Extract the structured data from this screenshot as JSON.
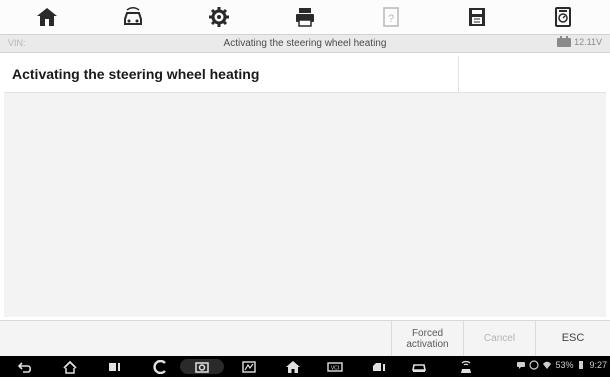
{
  "toolbar": {
    "buttons": [
      {
        "icon": "home-icon"
      },
      {
        "icon": "vehicle-swap-icon"
      },
      {
        "icon": "gear-icon"
      },
      {
        "icon": "print-icon"
      },
      {
        "icon": "help-icon"
      },
      {
        "icon": "save-icon"
      },
      {
        "icon": "data-logging-icon"
      }
    ]
  },
  "titlebar": {
    "vin_label": "VIN:",
    "title": "Activating the steering wheel heating",
    "voltage": "12.11V"
  },
  "content": {
    "row_title": "Activating the steering wheel heating",
    "row_value": ""
  },
  "functions": {
    "forced_line1": "Forced",
    "forced_line2": "activation",
    "cancel": "Cancel",
    "esc": "ESC"
  },
  "navbar": {
    "buttons": [
      "back-icon",
      "home-icon",
      "recent-apps-icon",
      "browser-icon",
      "camera-icon",
      "vci-icon",
      "maxisys-home-icon",
      "vci-manager-icon",
      "vehicle-menu-icon",
      "car-icon",
      "wifi-car-icon"
    ],
    "battery": "53%",
    "time": "9:27"
  },
  "colors": {
    "toolbar_icon": "#2a2a2a",
    "title_bar": "#eaeaea",
    "content_bg": "#f3f3f3",
    "navbar_bg": "#000000",
    "disabled_text": "#b4b4b4"
  }
}
